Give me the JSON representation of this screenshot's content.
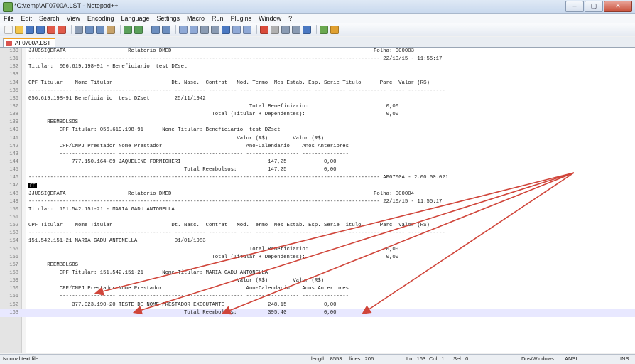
{
  "window": {
    "title": "*C:\\temp\\AF0700A.LST - Notepad++",
    "buttons": {
      "minimize": "–",
      "maximize": "▢",
      "close": "✕"
    }
  },
  "menu": [
    "File",
    "Edit",
    "Search",
    "View",
    "Encoding",
    "Language",
    "Settings",
    "Macro",
    "Run",
    "Plugins",
    "Window",
    "?"
  ],
  "toolbar_icons": [
    "new-file-icon",
    "open-file-icon",
    "save-icon",
    "save-all-icon",
    "close-icon",
    "close-all-icon",
    "print-icon",
    "cut-icon",
    "copy-icon",
    "paste-icon",
    "undo-icon",
    "redo-icon",
    "find-icon",
    "replace-icon",
    "zoom-in-icon",
    "zoom-out-icon",
    "sync-v-icon",
    "sync-h-icon",
    "word-wrap-icon",
    "all-chars-icon",
    "indent-guide-icon",
    "record-macro-icon",
    "stop-macro-icon",
    "play-macro-icon",
    "run-macro-icon",
    "save-macro-icon",
    "spellcheck-icon",
    "function-list-icon"
  ],
  "tab": {
    "label": "AF0700A.LST"
  },
  "editor": {
    "lines": [
      {
        "n": "130",
        "text": "JJUOSIQEFATA                    Relatorio DMED                                                                 Folha: 000003"
      },
      {
        "n": "131",
        "text": "----------------------------------------------------------------------------------------------------------------- 22/10/15 - 11:55:17"
      },
      {
        "n": "132",
        "text": "Titular:  056.619.198-91 - Beneficiario  test DZset"
      },
      {
        "n": "133",
        "text": ""
      },
      {
        "n": "134",
        "text": "CPF Titular    Nome Titular                   Dt. Nasc.  Contrat.  Mod. Termo  Mes Estab. Esp. Serie Titulo      Parc. Valor (R$)"
      },
      {
        "n": "135",
        "text": "-------------- ------------------------------- ---------- --------- ---- ------ ---- ------ ---- ----- ------------ ----- ------------"
      },
      {
        "n": "136",
        "text": "056.619.198-91 Beneficiario  test DZset        25/11/1942"
      },
      {
        "n": "137",
        "text": "                                                                       Total Beneficiario:                         0,00"
      },
      {
        "n": "138",
        "text": "                                                           Total (Titular + Dependentes):                          0,00"
      },
      {
        "n": "139",
        "text": "      REEMBOLSOS"
      },
      {
        "n": "140",
        "text": "          CPF Titular: 056.619.198-91      Nome Titular: Beneficiario  test DZset"
      },
      {
        "n": "141",
        "text": "                                                                   Valor (R$)        Valor (R$)"
      },
      {
        "n": "142",
        "text": "          CPF/CNPJ Prestador Nome Prestador                           Ano-Calendario    Anos Anteriores"
      },
      {
        "n": "143",
        "text": "          ------------------ ---------------------------------------- ----------------- ---------------"
      },
      {
        "n": "144",
        "text": "              777.150.164-89 JAQUELINE FORMIGHERI                            147,25            0,00"
      },
      {
        "n": "145",
        "text": "                                                  Total Reembolsos:          147,25            0,00"
      },
      {
        "n": "146",
        "text": "----------------------------------------------------------------------------------------------------------------- AF0700A - 2.00.00.021"
      },
      {
        "n": "147",
        "text": "",
        "ff": "FF"
      },
      {
        "n": "148",
        "text": "JJUOSIQEFATA                    Relatorio DMED                                                                 Folha: 000004"
      },
      {
        "n": "149",
        "text": "----------------------------------------------------------------------------------------------------------------- 22/10/15 - 11:55:17"
      },
      {
        "n": "150",
        "text": "Titular:  151.542.151-21 - MARIA GADU ANTONELLA"
      },
      {
        "n": "151",
        "text": ""
      },
      {
        "n": "152",
        "text": "CPF Titular    Nome Titular                   Dt. Nasc.  Contrat.  Mod. Termo  Mes Estab. Esp. Serie Titulo      Parc. Valor (R$)"
      },
      {
        "n": "153",
        "text": "-------------- ------------------------------- ---------- --------- ---- ------ ---- ------ ---- ----- ------------ ----- ------------"
      },
      {
        "n": "154",
        "text": "151.542.151-21 MARIA GADU ANTONELLA            01/01/1983"
      },
      {
        "n": "155",
        "text": "                                                                       Total Beneficiario:                         0,00"
      },
      {
        "n": "156",
        "text": "                                                           Total (Titular + Dependentes):                          0,00"
      },
      {
        "n": "157",
        "text": "      REEMBOLSOS"
      },
      {
        "n": "158",
        "text": "          CPF Titular: 151.542.151-21      Nome Titular: MARIA GADU ANTONELLA"
      },
      {
        "n": "159",
        "text": "                                                                   Valor (R$)        Valor (R$)"
      },
      {
        "n": "160",
        "text": "          CPF/CNPJ Prestador Nome Prestador                           Ano-Calendario    Anos Anteriores"
      },
      {
        "n": "161",
        "text": "          ------------------ ---------------------------------------- ----------------- ---------------"
      },
      {
        "n": "162",
        "text": "              377.023.190-20 TESTE DE NOME PRESTADOR EXECUTANTE              248,15            0,00"
      },
      {
        "n": "163",
        "text": "                                                  Total Reembolsos:          395,40            0,00"
      }
    ]
  },
  "status": {
    "file_type": "Normal text file",
    "length": "length : 8553",
    "lines": "lines : 206",
    "position": "Ln : 163",
    "column": "Col : 1",
    "selection": "Sel : 0",
    "eol": "Dos\\Windows",
    "encoding": "ANSI",
    "mode": "INS"
  },
  "colors": {
    "annotation_arrow": "#d0453a",
    "current_line": "#e8e8ff"
  }
}
